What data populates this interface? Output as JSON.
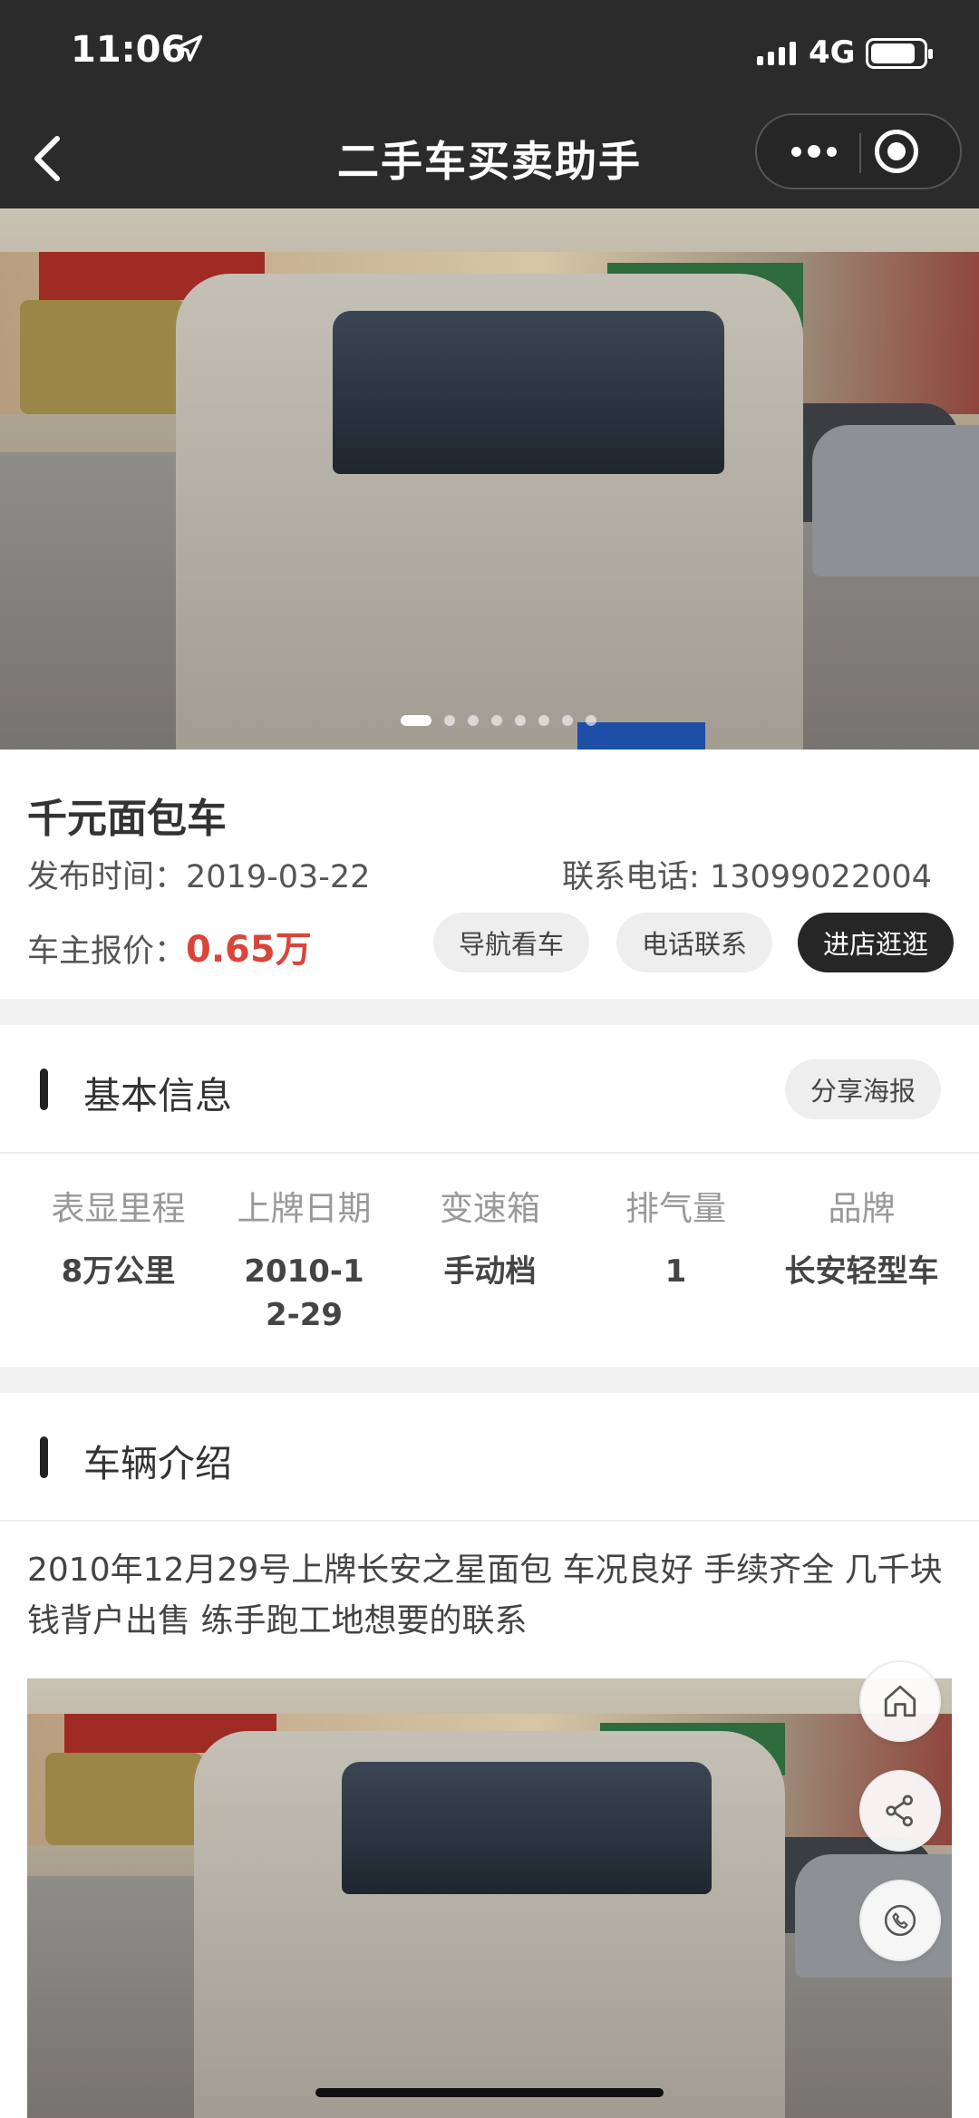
{
  "status_bar": {
    "time": "11:06",
    "network": "4G",
    "battery_level": 0.85
  },
  "nav": {
    "title": "二手车买卖助手"
  },
  "gallery": {
    "slide_count": 8,
    "active_index": 0
  },
  "listing": {
    "name": "千元面包车",
    "publish_label": "发布时间：",
    "publish_date": "2019-03-22",
    "phone_label": "联系电话:",
    "phone": "13099022004",
    "price_label": "车主报价：",
    "price": "0.65万",
    "actions": {
      "navigate": "导航看车",
      "call": "电话联系",
      "visit_store": "进店逛逛"
    }
  },
  "basic_info": {
    "title": "基本信息",
    "share_label": "分享海报",
    "specs": [
      {
        "label": "表显里程",
        "value": "8万公里"
      },
      {
        "label": "上牌日期",
        "value": "2010-12-29"
      },
      {
        "label": "变速箱",
        "value": "手动档"
      },
      {
        "label": "排气量",
        "value": "1"
      },
      {
        "label": "品牌",
        "value": "长安轻型车"
      }
    ]
  },
  "vehicle_intro": {
    "title": "车辆介绍",
    "text": "2010年12月29号上牌长安之星面包 车况良好 手续齐全 几千块钱背户出售 练手跑工地想要的联系"
  },
  "floating": {
    "home_icon": "home-icon",
    "share_icon": "share-icon",
    "phone_icon": "phone-icon"
  },
  "colors": {
    "price": "#d9453a",
    "header": "#2b2b2b",
    "dark_button": "#262626"
  }
}
